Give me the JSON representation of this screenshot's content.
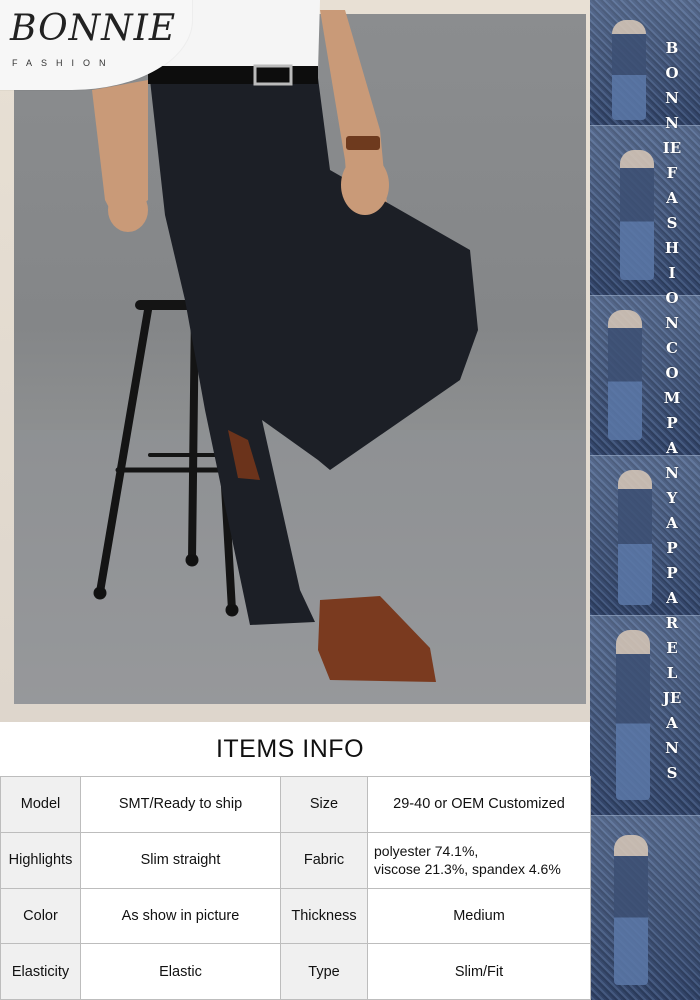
{
  "brand": {
    "name": "BONNIE",
    "tagline": "FASHION"
  },
  "side_banner": {
    "text": "BONNIE FASHION COMPANY APPAREL JEANS"
  },
  "photo": {
    "subject": "man-in-black-slim-trousers-on-stool-icon"
  },
  "info": {
    "title": "ITEMS INFO",
    "rows": [
      {
        "k1": "Model",
        "v1": "SMT/Ready to ship",
        "k2": "Size",
        "v2": "29-40 or OEM Customized"
      },
      {
        "k1": "Highlights",
        "v1": "Slim straight",
        "k2": "Fabric",
        "v2a": "polyester 74.1%,",
        "v2b": "viscose 21.3%, spandex 4.6%"
      },
      {
        "k1": "Color",
        "v1": "As show in picture",
        "k2": "Thickness",
        "v2": "Medium"
      },
      {
        "k1": "Elasticity",
        "v1": "Elastic",
        "k2": "Type",
        "v2": "Slim/Fit"
      }
    ]
  },
  "colors": {
    "trousers": "#1c1f26",
    "shoes": "#7a3a1f",
    "backdrop": "#8b8d8f",
    "key_cell": "#f0f0f0"
  }
}
